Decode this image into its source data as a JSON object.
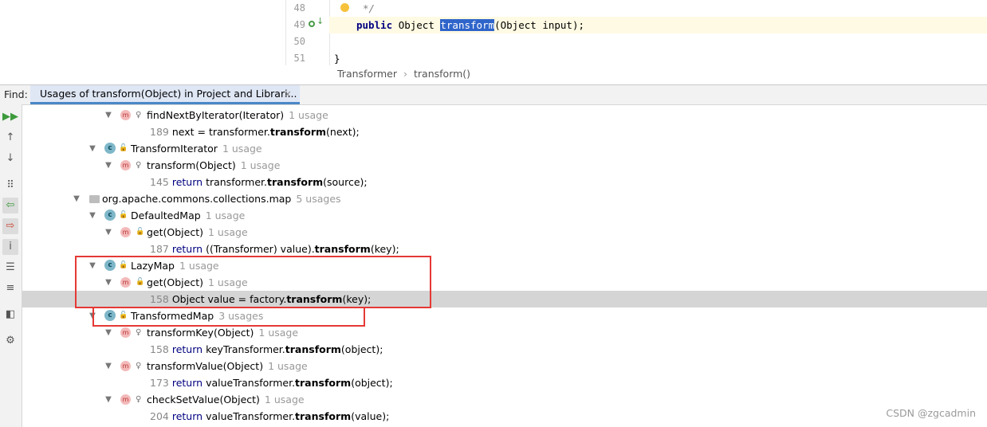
{
  "editor": {
    "lines": [
      {
        "num": "48",
        "code": "*/"
      },
      {
        "num": "49",
        "kw": "public",
        "pre": "Object",
        "sel": "transform",
        "post": "(Object input);"
      },
      {
        "num": "50",
        "code": ""
      },
      {
        "num": "51",
        "code": "}"
      }
    ],
    "breadcrumb": [
      "Transformer",
      "transform()"
    ]
  },
  "find": {
    "label": "Find:",
    "tab_title": "Usages of transform(Object) in Project and Librari...",
    "close": "×"
  },
  "toolbar": {
    "icons": [
      "rerun-icon",
      "previous-occurrence-icon",
      "next-occurrence-icon",
      "group-by-icon",
      "navigate-icon",
      "jump-icon",
      "info-icon",
      "expand-all-icon",
      "collapse-all-icon",
      "preview-icon",
      "settings-icon"
    ]
  },
  "tree": {
    "r1": {
      "name": "findNextByIterator(Iterator)",
      "count": "1 usage"
    },
    "r2": {
      "num": "189",
      "pre": "next = transformer.",
      "bold": "transform",
      "post": "(next);"
    },
    "r3": {
      "name": "TransformIterator",
      "count": "1 usage"
    },
    "r4": {
      "name": "transform(Object)",
      "count": "1 usage"
    },
    "r5": {
      "num": "145",
      "ret": "return",
      "pre": "transformer.",
      "bold": "transform",
      "post": "(source);"
    },
    "r6": {
      "name": "org.apache.commons.collections.map",
      "count": "5 usages"
    },
    "r7": {
      "name": "DefaultedMap",
      "count": "1 usage"
    },
    "r8": {
      "name": "get(Object)",
      "count": "1 usage"
    },
    "r9": {
      "num": "187",
      "ret": "return",
      "pre": "((Transformer) value).",
      "bold": "transform",
      "post": "(key);"
    },
    "r10": {
      "name": "LazyMap",
      "count": "1 usage"
    },
    "r11": {
      "name": "get(Object)",
      "count": "1 usage"
    },
    "r12": {
      "num": "158",
      "pre": "Object value = factory.",
      "bold": "transform",
      "post": "(key);"
    },
    "r13": {
      "name": "TransformedMap",
      "count": "3 usages"
    },
    "r14": {
      "name": "transformKey(Object)",
      "count": "1 usage"
    },
    "r15": {
      "num": "158",
      "ret": "return",
      "pre": "keyTransformer.",
      "bold": "transform",
      "post": "(object);"
    },
    "r16": {
      "name": "transformValue(Object)",
      "count": "1 usage"
    },
    "r17": {
      "num": "173",
      "ret": "return",
      "pre": "valueTransformer.",
      "bold": "transform",
      "post": "(object);"
    },
    "r18": {
      "name": "checkSetValue(Object)",
      "count": "1 usage"
    },
    "r19": {
      "num": "204",
      "ret": "return",
      "pre": "valueTransformer.",
      "bold": "transform",
      "post": "(value);"
    }
  },
  "watermark": "CSDN @zgcadmin",
  "colors": {
    "highlight_box": "#e53935",
    "selection": "#2f65ca",
    "current_line": "#fffae3"
  }
}
